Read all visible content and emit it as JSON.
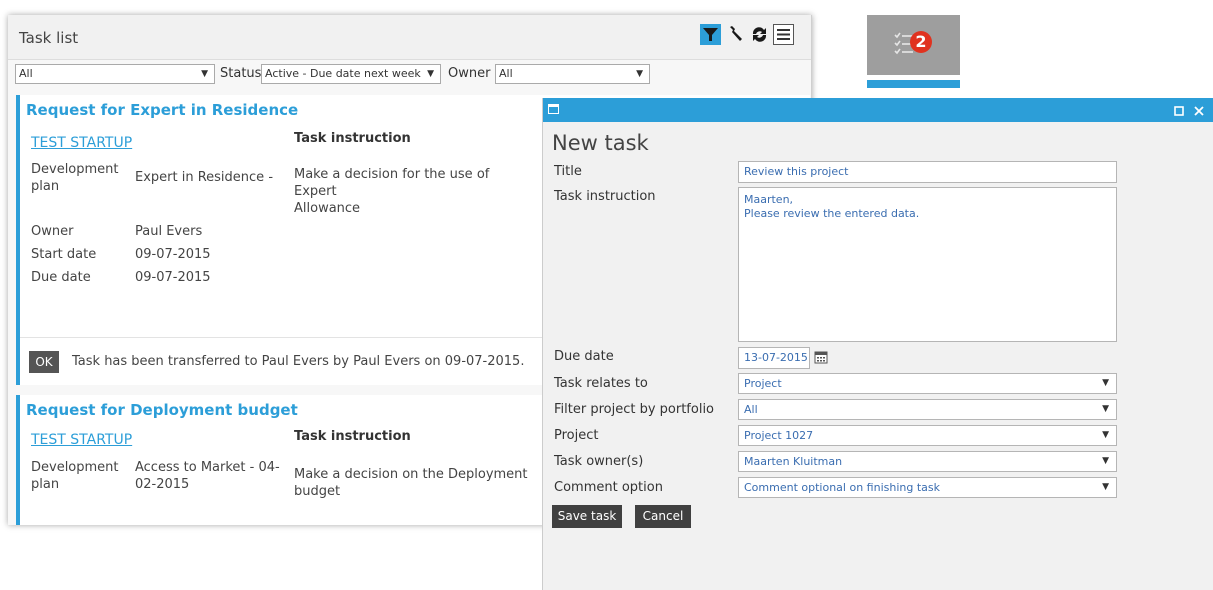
{
  "tasklist": {
    "title": "Task list",
    "filters": {
      "first_select": "All",
      "status_label": "Status",
      "status_value": "Active - Due date next week",
      "owner_label": "Owner",
      "owner_value": "All"
    },
    "tasks": [
      {
        "title": "Request for Expert in Residence",
        "startup": "TEST STARTUP",
        "plan_label_1": "Development",
        "plan_label_2": "plan",
        "plan_value": "Expert in Residence -",
        "instruction_heading": "Task instruction",
        "instruction_line1": "Make a decision for the use of Expert",
        "instruction_line2": "Allowance",
        "owner_label": "Owner",
        "owner_value": "Paul Evers",
        "start_label": "Start date",
        "start_value": "09-07-2015",
        "due_label": "Due date",
        "due_value": "09-07-2015",
        "ok_label": "OK",
        "transfer_text": "Task has been transferred to Paul Evers by Paul Evers on 09-07-2015."
      },
      {
        "title": "Request for Deployment budget",
        "startup": "TEST STARTUP",
        "plan_label_1": "Development",
        "plan_label_2": "plan",
        "plan_value_1": "Access to Market - 04-",
        "plan_value_2": "02-2015",
        "instruction_heading": "Task instruction",
        "instruction_line1": "Make a decision on the Deployment",
        "instruction_line2": "budget"
      }
    ]
  },
  "notification": {
    "count": "2",
    "icon": "task-list-icon"
  },
  "modal": {
    "title": "New task",
    "fields": {
      "title_label": "Title",
      "title_value": "Review this project",
      "instruction_label": "Task instruction",
      "instruction_line1": "Maarten,",
      "instruction_line2": "Please review the entered data.",
      "due_label": "Due date",
      "due_value": "13-07-2015",
      "relates_label": "Task relates to",
      "relates_value": "Project",
      "portfolio_label": "Filter project by portfolio",
      "portfolio_value": "All",
      "project_label": "Project",
      "project_value": "Project 1027",
      "owner_label": "Task owner(s)",
      "owner_value": "Maarten Kluitman",
      "comment_label": "Comment option",
      "comment_value": "Comment optional on finishing task"
    },
    "save_label": "Save task",
    "cancel_label": "Cancel"
  },
  "colors": {
    "accent": "#2c9ed8",
    "badge": "#e0321f",
    "button_dark": "#404040"
  }
}
